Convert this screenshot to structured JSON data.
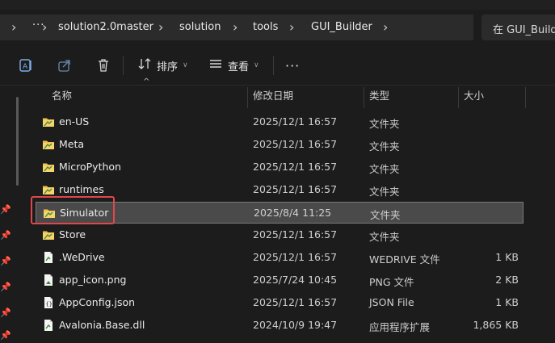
{
  "breadcrumb": {
    "items": [
      "solution2.0master",
      "solution",
      "tools",
      "GUI_Builder"
    ],
    "overflow": "···"
  },
  "search": {
    "placeholder": "在 GUI_Builder"
  },
  "toolbar": {
    "sort_label": "排序",
    "view_label": "查看",
    "more_label": "···"
  },
  "columns": {
    "name": "名称",
    "date": "修改日期",
    "type": "类型",
    "size": "大小"
  },
  "files": [
    {
      "name": "en-US",
      "date": "2025/12/1 16:57",
      "type": "文件夹",
      "size": "",
      "icon": "folder-icon"
    },
    {
      "name": "Meta",
      "date": "2025/12/1 16:57",
      "type": "文件夹",
      "size": "",
      "icon": "folder-icon"
    },
    {
      "name": "MicroPython",
      "date": "2025/12/1 16:57",
      "type": "文件夹",
      "size": "",
      "icon": "folder-icon"
    },
    {
      "name": "runtimes",
      "date": "2025/12/1 16:57",
      "type": "文件夹",
      "size": "",
      "icon": "folder-icon"
    },
    {
      "name": "Simulator",
      "date": "2025/8/4 11:25",
      "type": "文件夹",
      "size": "",
      "icon": "folder-icon",
      "selected": true
    },
    {
      "name": "Store",
      "date": "2025/12/1 16:57",
      "type": "文件夹",
      "size": "",
      "icon": "folder-icon"
    },
    {
      "name": ".WeDrive",
      "date": "2025/12/1 16:57",
      "type": "WEDRIVE 文件",
      "size": "1 KB",
      "icon": "file-icon"
    },
    {
      "name": "app_icon.png",
      "date": "2025/7/24 10:45",
      "type": "PNG 文件",
      "size": "2 KB",
      "icon": "image-file-icon"
    },
    {
      "name": "AppConfig.json",
      "date": "2025/12/1 16:57",
      "type": "JSON File",
      "size": "1 KB",
      "icon": "json-file-icon"
    },
    {
      "name": "Avalonia.Base.dll",
      "date": "2024/10/9 19:47",
      "type": "应用程序扩展",
      "size": "1,865 KB",
      "icon": "dll-file-icon"
    }
  ],
  "colors": {
    "background": "#1c1c1c",
    "selected_row": "#4a4a4a",
    "highlight_box": "#e0474c",
    "folder": "#f2c14e"
  }
}
